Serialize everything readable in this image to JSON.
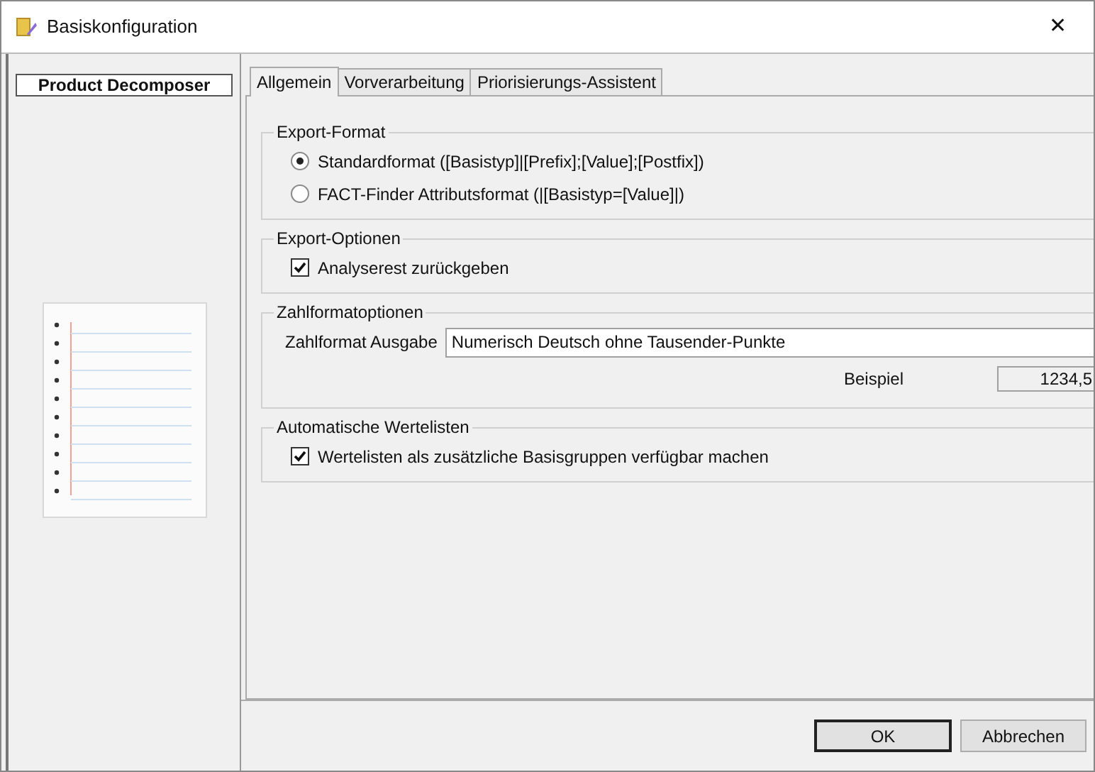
{
  "window": {
    "title": "Basiskonfiguration",
    "close": "✕"
  },
  "sidebar": {
    "title": "Product Decomposer"
  },
  "tabs": [
    {
      "label": "Allgemein",
      "selected": true
    },
    {
      "label": "Vorverarbeitung",
      "selected": false
    },
    {
      "label": "Priorisierungs-Assistent",
      "selected": false
    }
  ],
  "groups": [
    {
      "title": "Export-Format",
      "items": [
        {
          "kind": "radio",
          "label": "Standardformat ([Basistyp]|[Prefix];[Value];[Postfix])",
          "selected": true
        },
        {
          "kind": "radio",
          "label": "FACT-Finder Attributsformat (|[Basistyp=[Value]|)",
          "selected": false
        }
      ]
    },
    {
      "title": "Export-Optionen",
      "items": [
        {
          "kind": "checkbox",
          "label": "Analyserest zurückgeben",
          "checked": true
        }
      ]
    },
    {
      "title": "Zahlformatoptionen",
      "items": [
        {
          "kind": "field",
          "label": "Zahlformat Ausgabe",
          "value": "Numerisch Deutsch ohne Tausender-Punkte"
        },
        {
          "kind": "readout",
          "label": "Beispiel",
          "value": "1234,5"
        }
      ]
    },
    {
      "title": "Automatische Wertelisten",
      "items": [
        {
          "kind": "checkbox",
          "label": "Wertelisten als zusätzliche Basisgruppen verfügbar machen",
          "checked": true
        }
      ]
    }
  ],
  "buttons": [
    {
      "label": "OK",
      "default": true
    },
    {
      "label": "Abbrechen",
      "default": false
    }
  ]
}
